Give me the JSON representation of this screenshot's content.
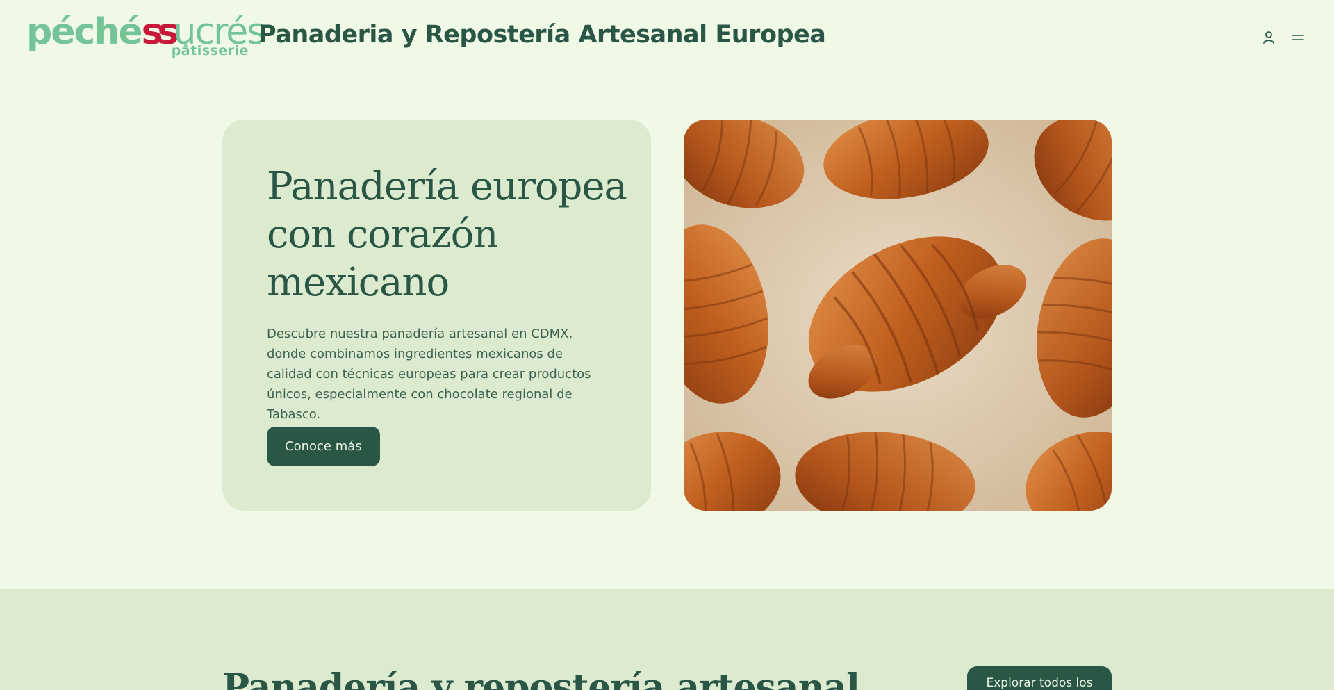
{
  "header": {
    "logo_main_1": "péché",
    "logo_main_2": "ss",
    "logo_main_3": "ucrés",
    "logo_sub": "pâtisserie",
    "title": "Panaderia y Repostería Artesanal Europea",
    "user_icon": "user-icon",
    "menu_icon": "menu-icon"
  },
  "hero": {
    "title": "Panadería europea con corazón mexicano",
    "description": "Descubre nuestra panadería artesanal en CDMX, donde combinamos ingredientes mexicanos de calidad con técnicas europeas para crear productos únicos, especialmente con chocolate regional de Tabasco.",
    "cta_label": "Conoce más",
    "image": "croissants-photo"
  },
  "section": {
    "title": "Panadería y repostería artesanal",
    "cta_label": "Explorar todos los"
  },
  "colors": {
    "background": "#eff9e6",
    "card": "#dcebcf",
    "primary": "#2a5646",
    "logo_green": "#74c496",
    "logo_red": "#c9193b"
  }
}
